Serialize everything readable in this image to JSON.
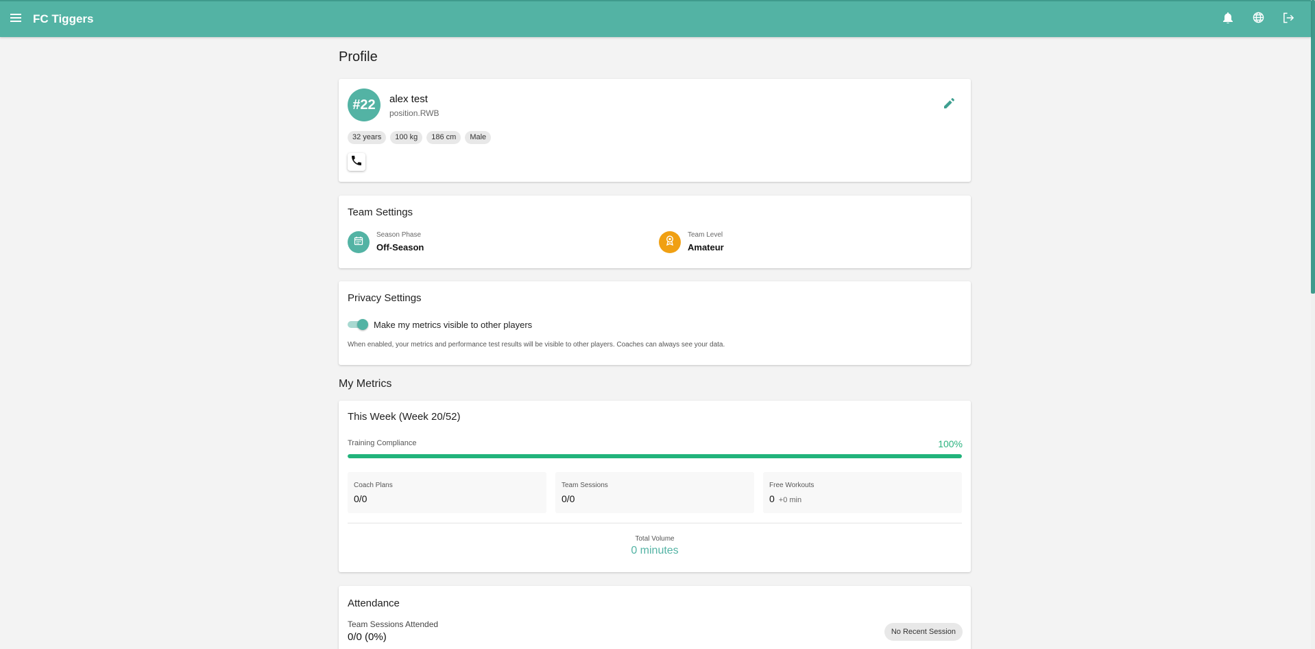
{
  "app": {
    "title": "FC Tiggers"
  },
  "icons": {
    "menu": "menu-icon",
    "bell": "bell-icon",
    "globe": "globe-icon",
    "logout": "logout-icon",
    "edit": "pencil-icon",
    "phone": "phone-icon",
    "calendar": "calendar-icon",
    "award": "award-icon"
  },
  "colors": {
    "brand": "#53b3a4",
    "accent_orange": "#f0a013",
    "success": "#21b37b"
  },
  "page": {
    "title": "Profile"
  },
  "profile": {
    "jersey": "#22",
    "name": "alex test",
    "position": "position.RWB",
    "chips": [
      "32 years",
      "100 kg",
      "186 cm",
      "Male"
    ]
  },
  "team_settings": {
    "title": "Team Settings",
    "season_phase_label": "Season Phase",
    "season_phase_value": "Off-Season",
    "team_level_label": "Team Level",
    "team_level_value": "Amateur"
  },
  "privacy": {
    "title": "Privacy Settings",
    "toggle_label": "Make my metrics visible to other players",
    "toggle_on": true,
    "hint": "When enabled, your metrics and performance test results will be visible to other players. Coaches can always see your data."
  },
  "metrics": {
    "section_title": "My Metrics",
    "week_title": "This Week (Week 20/52)",
    "compliance_label": "Training Compliance",
    "compliance_value": "100%",
    "compliance_fraction": 1.0,
    "coach_plans_label": "Coach Plans",
    "coach_plans_value": "0/0",
    "team_sessions_label": "Team Sessions",
    "team_sessions_value": "0/0",
    "free_workouts_label": "Free Workouts",
    "free_workouts_value": "0",
    "free_workouts_extra": "+0 min",
    "total_label": "Total Volume",
    "total_value": "0 minutes"
  },
  "attendance": {
    "title": "Attendance",
    "sessions_label": "Team Sessions Attended",
    "sessions_value": "0/0 (0%)",
    "badge": "No Recent Session"
  }
}
